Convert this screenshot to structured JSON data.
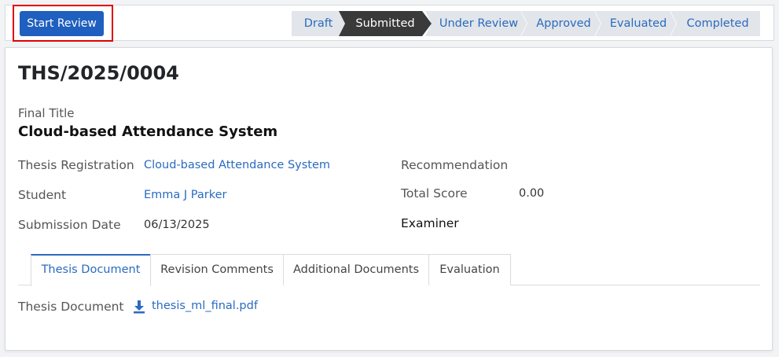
{
  "toolbar": {
    "start_review_label": "Start Review"
  },
  "stages": {
    "items": [
      {
        "label": "Draft"
      },
      {
        "label": "Submitted"
      },
      {
        "label": "Under Review"
      },
      {
        "label": "Approved"
      },
      {
        "label": "Evaluated"
      },
      {
        "label": "Completed"
      }
    ],
    "active": "Submitted"
  },
  "record": {
    "reference": "THS/2025/0004",
    "final_title_label": "Final Title",
    "final_title": "Cloud-based Attendance System",
    "thesis_registration_label": "Thesis Registration",
    "thesis_registration": "Cloud-based Attendance System",
    "student_label": "Student",
    "student": "Emma J Parker",
    "submission_date_label": "Submission Date",
    "submission_date": "06/13/2025",
    "recommendation_label": "Recommendation",
    "total_score_label": "Total Score",
    "total_score": "0.00",
    "examiner_label": "Examiner"
  },
  "tabs": [
    {
      "label": "Thesis Document"
    },
    {
      "label": "Revision Comments"
    },
    {
      "label": "Additional Documents"
    },
    {
      "label": "Evaluation"
    }
  ],
  "document": {
    "label": "Thesis Document",
    "icon": "download-icon",
    "file_name": "thesis_ml_final.pdf"
  },
  "colors": {
    "primary": "#1f5fbf",
    "link": "#2a6bc0",
    "active_stage": "#3a3a3a",
    "stage_bg": "#e2e5e9",
    "highlight": "#e00000"
  }
}
